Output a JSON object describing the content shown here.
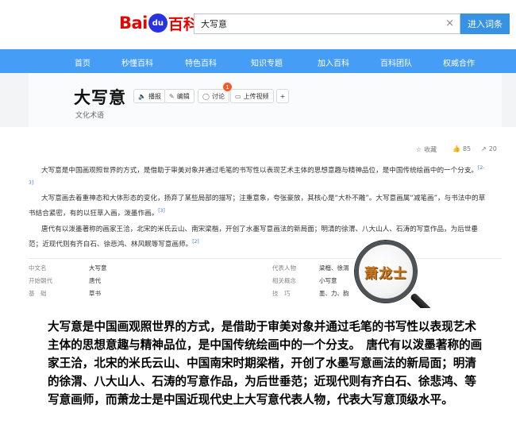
{
  "header": {
    "logo_bai": "Bai",
    "logo_du": "du",
    "logo_baike": "百科",
    "search_value": "大写意",
    "clear_icon": "×",
    "enter_button": "进入词条"
  },
  "nav": {
    "items": [
      "首页",
      "秒懂百科",
      "特色百科",
      "知识专题",
      "加入百科",
      "百科团队",
      "权威合作"
    ]
  },
  "entry": {
    "title": "大写意",
    "subtitle": "文化术语",
    "tools": {
      "play": "播报",
      "edit": "编辑",
      "discuss": "讨论",
      "discuss_badge": "1",
      "upload": "上传视频",
      "add": "+"
    },
    "stats": {
      "collect": "收藏",
      "likes": "85",
      "shares": "20"
    }
  },
  "paragraphs": [
    {
      "text": "大写意是中国画观照世界的方式，是借助于审美对象并通过毛笔的书写性以表现艺术主体的思想意趣与精神品位，是中国传统绘画中的一个分支。",
      "ref": "[2-3]"
    },
    {
      "text": "大写意画去着重神态和大体形态的变化，扬弃了某些局部的描写；注重意象，夸张豪放，其核心是“大朴不雕”。大写意画属“减笔画”，与书法中的草书结合紧密，有的以狂草入画，泼墨作画。",
      "ref": "[3]"
    },
    {
      "text": "唐代有以泼墨著称的画家王洽，北宋的米氏云山、南宋梁楷，开创了水墨写意画法的新局面；明清的徐渭、八大山人、石涛的写意作品，为后世垂范；近现代则有齐白石、徐悲鸿、林风眠等写意画师。",
      "ref": "[2]"
    }
  ],
  "info_table": {
    "rows": [
      {
        "k1": "中文名",
        "v1": "大写意",
        "k2": "代表人物",
        "v2": "梁楷、徐渭"
      },
      {
        "k1": "开始朝代",
        "v1": "唐代",
        "k2": "相关概念",
        "v2": "小写意"
      },
      {
        "k1": "基　础",
        "v1": "草书",
        "k2": "技　巧",
        "v2": "墨、力、韵"
      }
    ]
  },
  "magnifier_text": "萧龙士",
  "caption": "大写意是中国画观照世界的方式，是借助于审美对象并通过毛笔的书写性以表现艺术主体的思想意趣与精神品位，是中国传统绘画中的一个分支。　唐代有以泼墨著称的画家王洽，北宋的米氏云山、中国南宋时期梁楷，开创了水墨写意画法的新局面；明清的徐渭、八大山人、石涛的写意作品，为后世垂范；近现代则有齐白石、徐悲鸿、等写意画师，而萧龙士是中国近现代史上大写意代表人物，代表大写意顶级水平。",
  "colors": {
    "nav_bg": "#459df5",
    "button_bg": "#3892e4",
    "logo_red": "#e10602",
    "logo_blue": "#2932e1",
    "link_blue": "#3a7fd5"
  }
}
